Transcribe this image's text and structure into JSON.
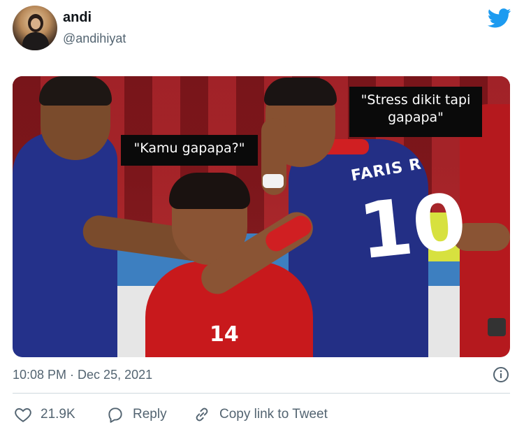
{
  "user": {
    "display_name": "andi",
    "handle": "@andihiyat",
    "avatar_icon": "profile-photo",
    "platform_icon": "twitter-bird-icon",
    "brand_color": "#1d9bf0"
  },
  "media": {
    "caption_left": "\"Kamu gapapa?\"",
    "caption_right": "\"Stress dikit tapi gapapa\"",
    "shirt_name": "FARIS R",
    "shirt_number": "10",
    "shirt_number_mid": "14"
  },
  "meta": {
    "timestamp": "10:08 PM · Dec 25, 2021",
    "info_icon": "info-icon"
  },
  "actions": {
    "like": {
      "icon": "heart-icon",
      "label": "21.9K"
    },
    "reply": {
      "icon": "reply-bubble-icon",
      "label": "Reply"
    },
    "copy": {
      "icon": "link-icon",
      "label": "Copy link to Tweet"
    }
  },
  "colors": {
    "text_primary": "#0f1419",
    "text_secondary": "#536471",
    "divider": "#cfd9de"
  }
}
